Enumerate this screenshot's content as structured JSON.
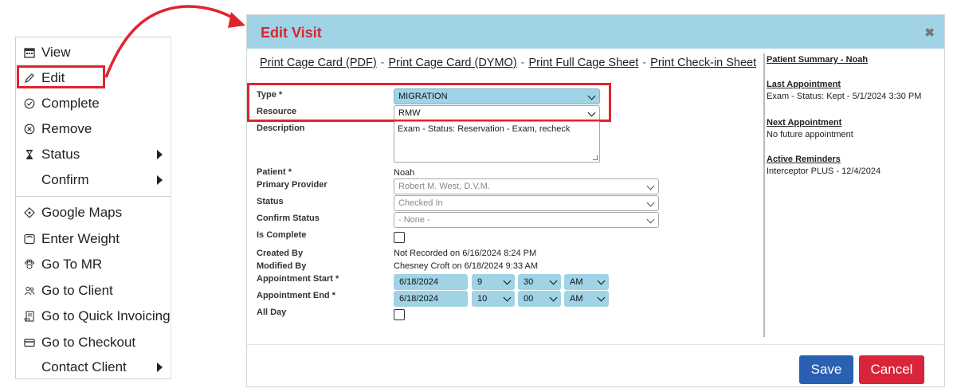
{
  "menu": {
    "items": [
      {
        "label": "View",
        "icon": "calendar-icon"
      },
      {
        "label": "Edit",
        "icon": "pencil-icon"
      },
      {
        "label": "Complete",
        "icon": "check-circle-icon"
      },
      {
        "label": "Remove",
        "icon": "x-circle-icon"
      },
      {
        "label": "Status",
        "icon": "hourglass-icon"
      },
      {
        "label": "Confirm",
        "icon": ""
      },
      {
        "label": "Google Maps",
        "icon": "map-pin-icon"
      },
      {
        "label": "Enter Weight",
        "icon": "scale-icon"
      },
      {
        "label": "Go To MR",
        "icon": "paw-icon"
      },
      {
        "label": "Go to Client",
        "icon": "people-icon"
      },
      {
        "label": "Go to Quick Invoicing",
        "icon": "invoice-icon"
      },
      {
        "label": "Go to Checkout",
        "icon": "credit-card-icon"
      },
      {
        "label": "Contact Client",
        "icon": ""
      }
    ]
  },
  "dialog": {
    "title": "Edit Visit",
    "close": "✖",
    "links": [
      "Print Cage Card (PDF)",
      "Print Cage Card (DYMO)",
      "Print Full Cage Sheet",
      "Print Check-in Sheet"
    ],
    "link_sep": "-",
    "form": {
      "type_label": "Type *",
      "type_value": "MIGRATION",
      "resource_label": "Resource",
      "resource_value": "RMW",
      "description_label": "Description",
      "description_value": "Exam - Status: Reservation - Exam, recheck",
      "patient_label": "Patient *",
      "patient_value": "Noah",
      "provider_label": "Primary Provider",
      "provider_value": "Robert M. West, D.V.M.",
      "status_label": "Status",
      "status_value": "Checked In",
      "confirm_label": "Confirm Status",
      "confirm_value": "- None -",
      "complete_label": "Is Complete",
      "created_label": "Created By",
      "created_value": "Not Recorded on 6/16/2024 8:24 PM",
      "modified_label": "Modified By",
      "modified_value": "Chesney Croft on 6/18/2024 9:33 AM",
      "start_label": "Appointment Start *",
      "start_date": "6/18/2024",
      "start_hour": "9",
      "start_min": "30",
      "start_ampm": "AM",
      "end_label": "Appointment End *",
      "end_date": "6/18/2024",
      "end_hour": "10",
      "end_min": "00",
      "end_ampm": "AM",
      "allday_label": "All Day"
    },
    "summary": {
      "title": "Patient Summary - Noah",
      "last_label": "Last Appointment",
      "last_value": "Exam - Status: Kept - 5/1/2024 3:30 PM",
      "next_label": "Next Appointment",
      "next_value": "No future appointment",
      "reminders_label": "Active Reminders",
      "reminders_value": "Interceptor PLUS - 12/4/2024"
    },
    "save_label": "Save",
    "cancel_label": "Cancel"
  },
  "colors": {
    "accent_red": "#e0242f",
    "header_blue": "#9fd3e5",
    "save_blue": "#2a60b1",
    "cancel_red": "#d9243a"
  }
}
